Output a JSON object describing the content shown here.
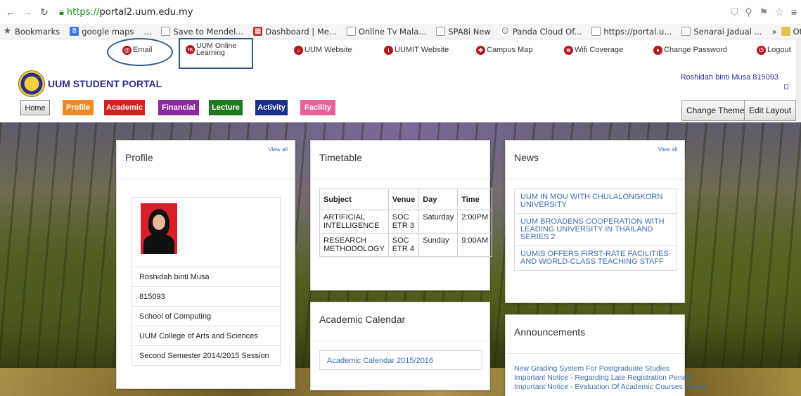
{
  "browser": {
    "url_protocol": "https://",
    "url_host": "portal2.uum.edu.my",
    "bookmarks": [
      {
        "label": "Bookmarks",
        "icon": "star-icon"
      },
      {
        "label": "google maps",
        "icon": "google-icon"
      },
      {
        "label": "...",
        "icon": ""
      },
      {
        "label": "Save to Mendel...",
        "icon": "doc-icon"
      },
      {
        "label": "Dashboard | Me...",
        "icon": "dashboard-icon"
      },
      {
        "label": "Online Tv Mala...",
        "icon": "doc-icon"
      },
      {
        "label": "SPA8i New",
        "icon": "doc-icon"
      },
      {
        "label": "Panda Cloud Of...",
        "icon": "panda-icon"
      },
      {
        "label": "https://portal.u...",
        "icon": "doc-icon"
      },
      {
        "label": "Senarai Jadual ...",
        "icon": "doc-icon"
      },
      {
        "label": "»",
        "icon": ""
      },
      {
        "label": "Other bookmarks",
        "icon": "folder-icon"
      }
    ]
  },
  "toplinks": {
    "email": "Email",
    "online_learning_1": "UUM Online",
    "online_learning_2": "Learning",
    "website": "UUM Website",
    "uumit": "UUMIT Website",
    "campus_map": "Campus Map",
    "wifi": "Wifi Coverage",
    "change_password": "Change Password",
    "logout": "Logout"
  },
  "header": {
    "title": "UUM STUDENT PORTAL",
    "user": "Roshidah binti Musa 815093"
  },
  "nav": {
    "tabs": [
      {
        "label": "Home",
        "color": "#e0e0e0"
      },
      {
        "label": "Profile",
        "color": "#f08a24"
      },
      {
        "label": "Academic",
        "color": "#d42020"
      },
      {
        "label": "Financial",
        "color": "#8a2a9e"
      },
      {
        "label": "Lecture",
        "color": "#1e7a1e"
      },
      {
        "label": "Activity",
        "color": "#1a2e8a"
      },
      {
        "label": "Facility",
        "color": "#e8609a"
      }
    ],
    "change_theme": "Change Theme",
    "edit_layout": "Edit Layout"
  },
  "profile": {
    "title": "Profile",
    "view_all": "View all",
    "name": "Roshidah binti Musa",
    "id": "815093",
    "school": "School of Computing",
    "college": "UUM College of Arts and Sciences",
    "session": "Second Semester 2014/2015 Session"
  },
  "timetable": {
    "title": "Timetable",
    "headers": [
      "Subject",
      "Venue",
      "Day",
      "Time"
    ],
    "rows": [
      [
        "ARTIFICIAL INTELLIGENCE",
        "SOC ETR 3",
        "Saturday",
        "2:00PM"
      ],
      [
        "RESEARCH METHODOLOGY",
        "SOC ETR 4",
        "Sunday",
        "9:00AM"
      ]
    ]
  },
  "calendar": {
    "title": "Academic Calendar",
    "link": "Academic Calendar 2015/2016"
  },
  "news": {
    "title": "News",
    "view_all": "View all",
    "items": [
      "UUM IN MOU WITH CHULALONGKORN UNIVERSITY",
      "UUM BROADENS COOPERATION WITH LEADING UNIVERSITY IN THAILAND SERIES 2",
      "UUMIS OFFERS FIRST-RATE FACILITIES AND WORLD-CLASS TEACHING STAFF"
    ]
  },
  "announcements": {
    "title": "Announcements",
    "items": [
      "New Grading System For Postgraduate Studies",
      "Important Notice - Regarding Late Registration Penalty",
      "Important Notice - Evaluation Of Academic Courses Survey"
    ]
  }
}
